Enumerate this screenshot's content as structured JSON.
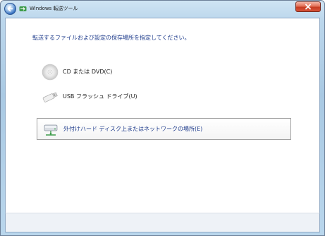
{
  "window": {
    "title": "Windows 転送ツール"
  },
  "main": {
    "heading": "転送するファイルおよび設定の保存場所を指定してください。",
    "options": [
      {
        "label": "CD または DVD(C)",
        "icon": "cd-dvd-icon",
        "selected": false
      },
      {
        "label": "USB フラッシュ ドライブ(U)",
        "icon": "usb-drive-icon",
        "selected": false
      },
      {
        "label": "外付けハード ディスク上またはネットワークの場所(E)",
        "icon": "external-disk-network-icon",
        "selected": true
      }
    ]
  },
  "colors": {
    "heading": "#1f3c8c",
    "close_button": "#c63d22",
    "selected_border": "#a0a0a0"
  }
}
